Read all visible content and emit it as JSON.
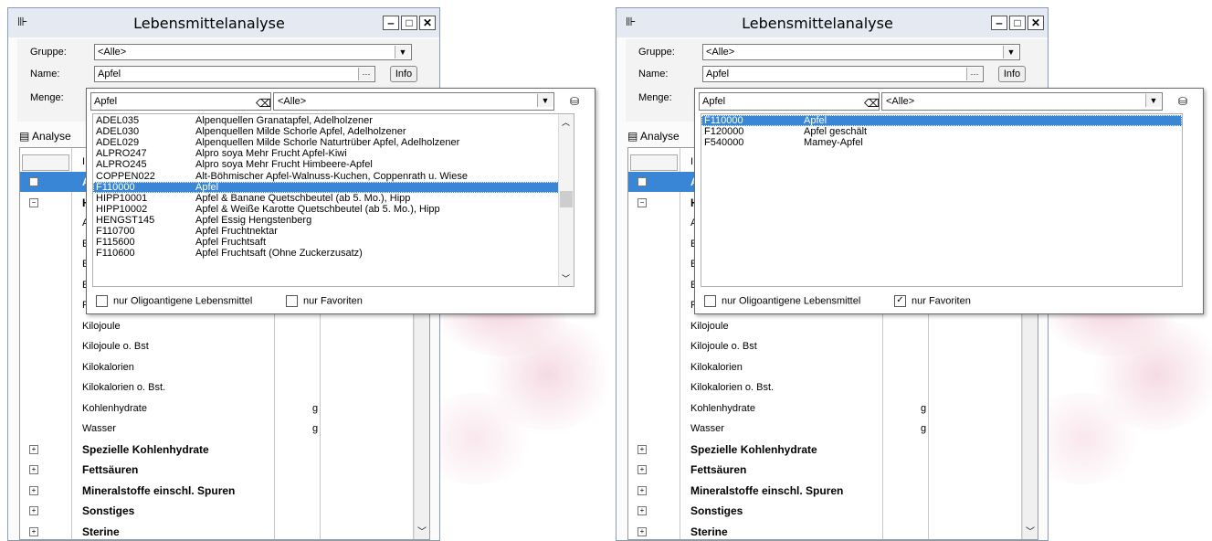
{
  "panels": [
    {
      "window": {
        "title": "Lebensmittelanalyse",
        "btn_min": "‒",
        "btn_max": "□",
        "btn_close": "✕"
      },
      "form": {
        "gruppe_label": "Gruppe:",
        "gruppe_value": "<Alle>",
        "name_label": "Name:",
        "name_value": "Apfel",
        "dots": "···",
        "info": "Info",
        "menge_label": "Menge:"
      },
      "tab": {
        "label": "Analyse"
      },
      "grid": {
        "col_header": "I",
        "rows": [
          {
            "pm": "+",
            "name": "A",
            "unit": "",
            "bold": true,
            "sel": true
          },
          {
            "pm": "−",
            "name": "H",
            "unit": "",
            "bold": true
          },
          {
            "pm": "",
            "name": "A",
            "unit": ""
          },
          {
            "pm": "",
            "name": "E",
            "unit": ""
          },
          {
            "pm": "",
            "name": "E",
            "unit": ""
          },
          {
            "pm": "",
            "name": "E",
            "unit": ""
          },
          {
            "pm": "",
            "name": "F",
            "unit": ""
          },
          {
            "pm": "",
            "name": "Kilojoule",
            "unit": ""
          },
          {
            "pm": "",
            "name": "Kilojoule o. Bst",
            "unit": ""
          },
          {
            "pm": "",
            "name": "Kilokalorien",
            "unit": ""
          },
          {
            "pm": "",
            "name": "Kilokalorien o. Bst.",
            "unit": ""
          },
          {
            "pm": "",
            "name": "Kohlenhydrate",
            "unit": "g"
          },
          {
            "pm": "",
            "name": "Wasser",
            "unit": "g"
          },
          {
            "pm": "+",
            "name": "Spezielle Kohlenhydrate",
            "unit": "",
            "bold": true
          },
          {
            "pm": "+",
            "name": "Fettsäuren",
            "unit": "",
            "bold": true
          },
          {
            "pm": "+",
            "name": "Mineralstoffe einschl. Spuren",
            "unit": "",
            "bold": true
          },
          {
            "pm": "+",
            "name": "Sonstiges",
            "unit": "",
            "bold": true
          },
          {
            "pm": "+",
            "name": "Sterine",
            "unit": "",
            "bold": true
          }
        ]
      },
      "dropdown": {
        "search_value": "Apfel",
        "group_value": "<Alle>",
        "items": [
          {
            "code": "ADEL035",
            "desc": "Alpenquellen Granatapfel, Adelholzener"
          },
          {
            "code": "ADEL030",
            "desc": "Alpenquellen Milde Schorle Apfel, Adelholzener"
          },
          {
            "code": "ADEL029",
            "desc": "Alpenquellen Milde Schorle Naturtrüber Apfel, Adelholzener"
          },
          {
            "code": "ALPRO247",
            "desc": "Alpro soya Mehr Frucht Apfel-Kiwi"
          },
          {
            "code": "ALPRO245",
            "desc": "Alpro soya Mehr Frucht Himbeere-Apfel"
          },
          {
            "code": "COPPEN022",
            "desc": "Alt-Böhmischer Apfel-Walnuss-Kuchen, Coppenrath u. Wiese"
          },
          {
            "code": "F110000",
            "desc": "Apfel",
            "sel": true
          },
          {
            "code": "HIPP10001",
            "desc": "Apfel & Banane Quetschbeutel (ab 5. Mo.), Hipp"
          },
          {
            "code": "HIPP10002",
            "desc": "Apfel & Weiße Karotte Quetschbeutel (ab 5. Mo.), Hipp"
          },
          {
            "code": "HENGST145",
            "desc": "Apfel Essig Hengstenberg"
          },
          {
            "code": "F110700",
            "desc": "Apfel Fruchtnektar"
          },
          {
            "code": "F115600",
            "desc": "Apfel Fruchtsaft"
          },
          {
            "code": "F110600",
            "desc": "Apfel Fruchtsaft (Ohne Zuckerzusatz)"
          }
        ],
        "has_scrollbar": true,
        "opt1_label": "nur Oligoantigene Lebensmittel",
        "opt1_checked": false,
        "opt2_label": "nur Favoriten",
        "opt2_checked": false
      }
    },
    {
      "window": {
        "title": "Lebensmittelanalyse",
        "btn_min": "‒",
        "btn_max": "□",
        "btn_close": "✕"
      },
      "form": {
        "gruppe_label": "Gruppe:",
        "gruppe_value": "<Alle>",
        "name_label": "Name:",
        "name_value": "Apfel",
        "dots": "···",
        "info": "Info",
        "menge_label": "Menge:"
      },
      "tab": {
        "label": "Analyse"
      },
      "grid": {
        "col_header": "I",
        "rows": [
          {
            "pm": "+",
            "name": "A",
            "unit": "",
            "bold": true,
            "sel": true
          },
          {
            "pm": "−",
            "name": "H",
            "unit": "",
            "bold": true
          },
          {
            "pm": "",
            "name": "A",
            "unit": ""
          },
          {
            "pm": "",
            "name": "E",
            "unit": ""
          },
          {
            "pm": "",
            "name": "E",
            "unit": ""
          },
          {
            "pm": "",
            "name": "E",
            "unit": ""
          },
          {
            "pm": "",
            "name": "F",
            "unit": ""
          },
          {
            "pm": "",
            "name": "Kilojoule",
            "unit": ""
          },
          {
            "pm": "",
            "name": "Kilojoule o. Bst",
            "unit": ""
          },
          {
            "pm": "",
            "name": "Kilokalorien",
            "unit": ""
          },
          {
            "pm": "",
            "name": "Kilokalorien o. Bst.",
            "unit": ""
          },
          {
            "pm": "",
            "name": "Kohlenhydrate",
            "unit": "g"
          },
          {
            "pm": "",
            "name": "Wasser",
            "unit": "g"
          },
          {
            "pm": "+",
            "name": "Spezielle Kohlenhydrate",
            "unit": "",
            "bold": true
          },
          {
            "pm": "+",
            "name": "Fettsäuren",
            "unit": "",
            "bold": true
          },
          {
            "pm": "+",
            "name": "Mineralstoffe einschl. Spuren",
            "unit": "",
            "bold": true
          },
          {
            "pm": "+",
            "name": "Sonstiges",
            "unit": "",
            "bold": true
          },
          {
            "pm": "+",
            "name": "Sterine",
            "unit": "",
            "bold": true
          }
        ]
      },
      "dropdown": {
        "search_value": "Apfel",
        "group_value": "<Alle>",
        "items": [
          {
            "code": "F110000",
            "desc": "Apfel",
            "sel": true
          },
          {
            "code": "F120000",
            "desc": "Apfel geschält"
          },
          {
            "code": "F540000",
            "desc": "Mamey-Apfel"
          }
        ],
        "has_scrollbar": false,
        "opt1_label": "nur Oligoantigene Lebensmittel",
        "opt1_checked": false,
        "opt2_label": "nur Favoriten",
        "opt2_checked": true
      }
    }
  ],
  "colors": {
    "selection": "#3a86d6",
    "window_border": "#8a9bb5",
    "blossom": "#e9b8c8"
  }
}
